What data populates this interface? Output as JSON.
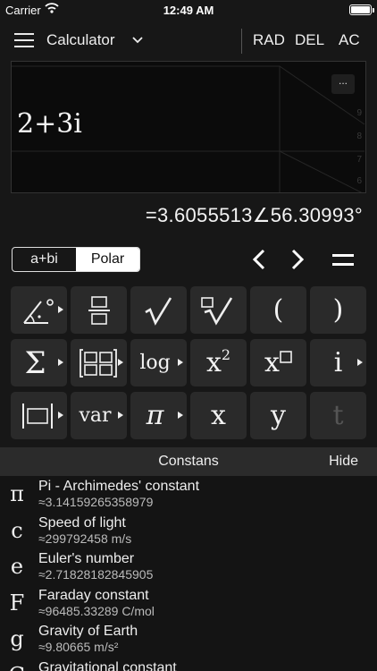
{
  "status": {
    "carrier": "Carrier",
    "time": "12:49 AM"
  },
  "nav": {
    "title": "Calculator",
    "rad": "RAD",
    "del": "DEL",
    "ac": "AC"
  },
  "display": {
    "expression": "2+3i",
    "more": "...",
    "axis_ticks": [
      "9",
      "8",
      "7",
      "6"
    ]
  },
  "result": "=3.6055513∠56.30993°",
  "mode": {
    "rect": "a+bi",
    "polar": "Polar",
    "selected": "Polar"
  },
  "keys": {
    "paren_open": "(",
    "paren_close": ")",
    "log": "log",
    "x": "x",
    "i": "i",
    "var": "var",
    "y": "y",
    "t": "t",
    "pi": "π",
    "sigma": "Σ"
  },
  "constants": {
    "title": "Constans",
    "hide": "Hide",
    "items": [
      {
        "symbol": "π",
        "name": "Pi - Archimedes' constant",
        "value": "≈3.14159265358979"
      },
      {
        "symbol": "c",
        "name": "Speed of light",
        "value": "≈299792458 m/s"
      },
      {
        "symbol": "e",
        "name": "Euler's number",
        "value": "≈2.71828182845905"
      },
      {
        "symbol": "F",
        "name": "Faraday constant",
        "value": "≈96485.33289 C/mol"
      },
      {
        "symbol": "g",
        "name": "Gravity of Earth",
        "value": "≈9.80665 m/s²"
      },
      {
        "symbol": "G",
        "name": "Gravitational constant",
        "value": ""
      }
    ]
  }
}
